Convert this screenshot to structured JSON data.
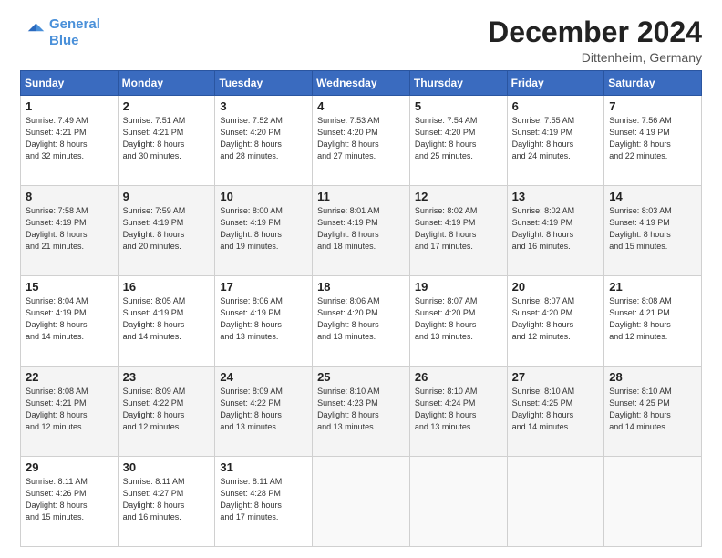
{
  "header": {
    "logo_line1": "General",
    "logo_line2": "Blue",
    "title": "December 2024",
    "subtitle": "Dittenheim, Germany"
  },
  "calendar": {
    "days_of_week": [
      "Sunday",
      "Monday",
      "Tuesday",
      "Wednesday",
      "Thursday",
      "Friday",
      "Saturday"
    ],
    "weeks": [
      [
        {
          "day": "1",
          "sunrise": "7:49 AM",
          "sunset": "4:21 PM",
          "daylight": "8 hours and 32 minutes."
        },
        {
          "day": "2",
          "sunrise": "7:51 AM",
          "sunset": "4:21 PM",
          "daylight": "8 hours and 30 minutes."
        },
        {
          "day": "3",
          "sunrise": "7:52 AM",
          "sunset": "4:20 PM",
          "daylight": "8 hours and 28 minutes."
        },
        {
          "day": "4",
          "sunrise": "7:53 AM",
          "sunset": "4:20 PM",
          "daylight": "8 hours and 27 minutes."
        },
        {
          "day": "5",
          "sunrise": "7:54 AM",
          "sunset": "4:20 PM",
          "daylight": "8 hours and 25 minutes."
        },
        {
          "day": "6",
          "sunrise": "7:55 AM",
          "sunset": "4:19 PM",
          "daylight": "8 hours and 24 minutes."
        },
        {
          "day": "7",
          "sunrise": "7:56 AM",
          "sunset": "4:19 PM",
          "daylight": "8 hours and 22 minutes."
        }
      ],
      [
        {
          "day": "8",
          "sunrise": "7:58 AM",
          "sunset": "4:19 PM",
          "daylight": "8 hours and 21 minutes."
        },
        {
          "day": "9",
          "sunrise": "7:59 AM",
          "sunset": "4:19 PM",
          "daylight": "8 hours and 20 minutes."
        },
        {
          "day": "10",
          "sunrise": "8:00 AM",
          "sunset": "4:19 PM",
          "daylight": "8 hours and 19 minutes."
        },
        {
          "day": "11",
          "sunrise": "8:01 AM",
          "sunset": "4:19 PM",
          "daylight": "8 hours and 18 minutes."
        },
        {
          "day": "12",
          "sunrise": "8:02 AM",
          "sunset": "4:19 PM",
          "daylight": "8 hours and 17 minutes."
        },
        {
          "day": "13",
          "sunrise": "8:02 AM",
          "sunset": "4:19 PM",
          "daylight": "8 hours and 16 minutes."
        },
        {
          "day": "14",
          "sunrise": "8:03 AM",
          "sunset": "4:19 PM",
          "daylight": "8 hours and 15 minutes."
        }
      ],
      [
        {
          "day": "15",
          "sunrise": "8:04 AM",
          "sunset": "4:19 PM",
          "daylight": "8 hours and 14 minutes."
        },
        {
          "day": "16",
          "sunrise": "8:05 AM",
          "sunset": "4:19 PM",
          "daylight": "8 hours and 14 minutes."
        },
        {
          "day": "17",
          "sunrise": "8:06 AM",
          "sunset": "4:19 PM",
          "daylight": "8 hours and 13 minutes."
        },
        {
          "day": "18",
          "sunrise": "8:06 AM",
          "sunset": "4:20 PM",
          "daylight": "8 hours and 13 minutes."
        },
        {
          "day": "19",
          "sunrise": "8:07 AM",
          "sunset": "4:20 PM",
          "daylight": "8 hours and 13 minutes."
        },
        {
          "day": "20",
          "sunrise": "8:07 AM",
          "sunset": "4:20 PM",
          "daylight": "8 hours and 12 minutes."
        },
        {
          "day": "21",
          "sunrise": "8:08 AM",
          "sunset": "4:21 PM",
          "daylight": "8 hours and 12 minutes."
        }
      ],
      [
        {
          "day": "22",
          "sunrise": "8:08 AM",
          "sunset": "4:21 PM",
          "daylight": "8 hours and 12 minutes."
        },
        {
          "day": "23",
          "sunrise": "8:09 AM",
          "sunset": "4:22 PM",
          "daylight": "8 hours and 12 minutes."
        },
        {
          "day": "24",
          "sunrise": "8:09 AM",
          "sunset": "4:22 PM",
          "daylight": "8 hours and 13 minutes."
        },
        {
          "day": "25",
          "sunrise": "8:10 AM",
          "sunset": "4:23 PM",
          "daylight": "8 hours and 13 minutes."
        },
        {
          "day": "26",
          "sunrise": "8:10 AM",
          "sunset": "4:24 PM",
          "daylight": "8 hours and 13 minutes."
        },
        {
          "day": "27",
          "sunrise": "8:10 AM",
          "sunset": "4:25 PM",
          "daylight": "8 hours and 14 minutes."
        },
        {
          "day": "28",
          "sunrise": "8:10 AM",
          "sunset": "4:25 PM",
          "daylight": "8 hours and 14 minutes."
        }
      ],
      [
        {
          "day": "29",
          "sunrise": "8:11 AM",
          "sunset": "4:26 PM",
          "daylight": "8 hours and 15 minutes."
        },
        {
          "day": "30",
          "sunrise": "8:11 AM",
          "sunset": "4:27 PM",
          "daylight": "8 hours and 16 minutes."
        },
        {
          "day": "31",
          "sunrise": "8:11 AM",
          "sunset": "4:28 PM",
          "daylight": "8 hours and 17 minutes."
        },
        null,
        null,
        null,
        null
      ]
    ]
  },
  "labels": {
    "sunrise_label": "Sunrise:",
    "sunset_label": "Sunset:",
    "daylight_label": "Daylight:"
  }
}
